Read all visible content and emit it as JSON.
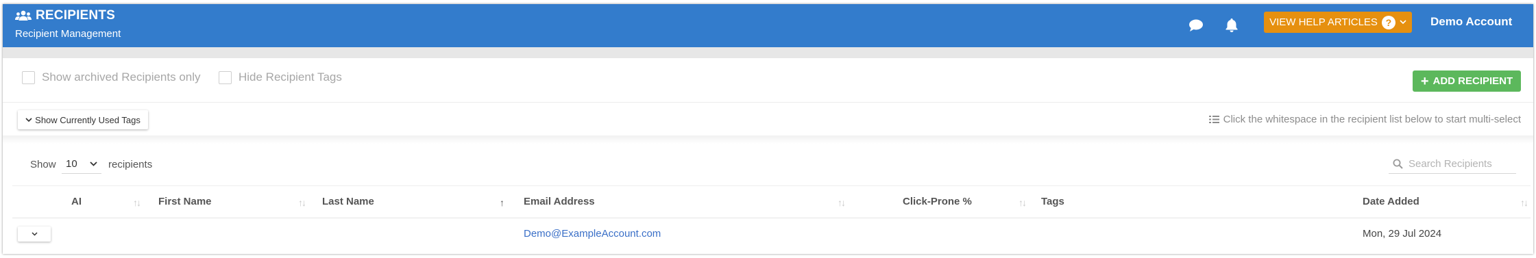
{
  "header": {
    "title": "RECIPIENTS",
    "subtitle": "Recipient Management",
    "help_label": "VIEW HELP ARTICLES",
    "help_q": "?",
    "account": "Demo Account",
    "bg_color": "#337ccc",
    "help_color": "#e6900f"
  },
  "options": {
    "archived_label": "Show archived Recipients only",
    "hide_tags_label": "Hide Recipient Tags",
    "add_label": "ADD RECIPIENT",
    "add_color": "#5cb85c",
    "tags_toggle_label": "Show Currently Used Tags",
    "multiselect_hint": "Click the whitespace in the recipient list below to start multi-select"
  },
  "table_controls": {
    "show_label": "Show",
    "page_length": "10",
    "recipients_label": "recipients",
    "search_placeholder": "Search Recipients"
  },
  "table": {
    "columns": [
      "AI",
      "First Name",
      "Last Name",
      "Email Address",
      "Click-Prone %",
      "Tags",
      "Date Added"
    ],
    "sorted_column": "Last Name",
    "rows": [
      {
        "ai": "",
        "first_name": "",
        "last_name": "",
        "email": "Demo@ExampleAccount.com",
        "click_prone": "",
        "tags": "",
        "date_added": "Mon, 29 Jul 2024"
      }
    ]
  }
}
